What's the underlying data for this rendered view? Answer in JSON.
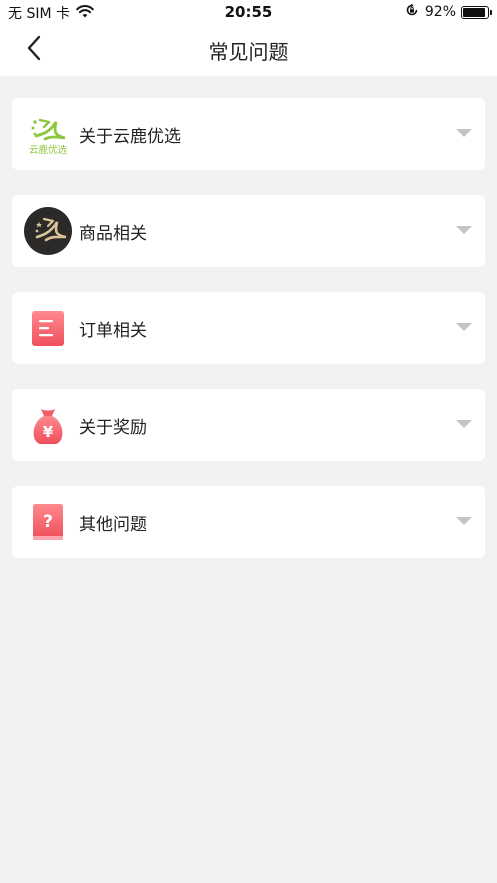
{
  "status_bar": {
    "carrier": "无 SIM 卡",
    "time": "20:55",
    "battery_percent": "92%",
    "battery_level": 0.92
  },
  "nav": {
    "title": "常见问题",
    "back_icon": "chevron-left-icon"
  },
  "faq_items": [
    {
      "label": "关于云鹿优选",
      "icon": "yunlu-logo-icon",
      "logo_text": "云鹿优选"
    },
    {
      "label": "商品相关",
      "icon": "deer-logo-dark-icon"
    },
    {
      "label": "订单相关",
      "icon": "order-list-icon"
    },
    {
      "label": "关于奖励",
      "icon": "money-bag-icon",
      "icon_glyph": "¥"
    },
    {
      "label": "其他问题",
      "icon": "question-book-icon",
      "icon_glyph": "?"
    }
  ],
  "colors": {
    "background": "#f2f2f2",
    "card": "#ffffff",
    "accent_red": "#f05a63",
    "logo_green": "#8dc63f",
    "arrow": "#c4c4c4"
  }
}
